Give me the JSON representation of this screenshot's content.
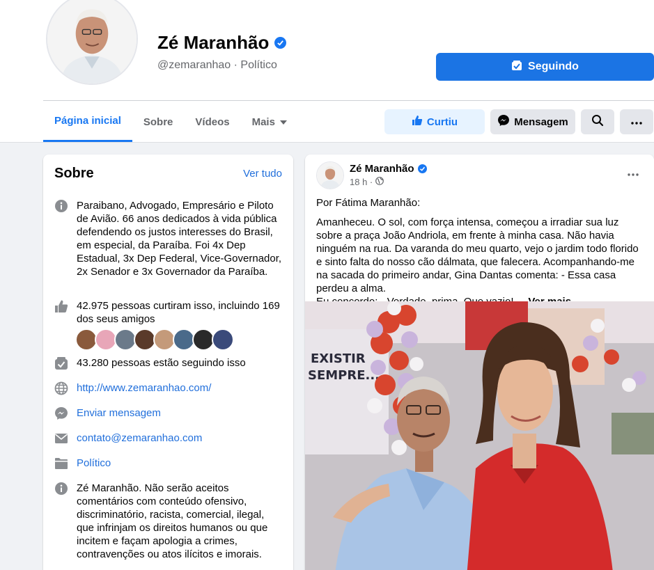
{
  "header": {
    "page_name": "Zé Maranhão",
    "handle": "@zemaranhao · Político",
    "following_button": "Seguindo"
  },
  "tabs": [
    {
      "label": "Página inicial"
    },
    {
      "label": "Sobre"
    },
    {
      "label": "Vídeos"
    },
    {
      "label": "Mais"
    }
  ],
  "actions": {
    "like_label": "Curtiu",
    "message_label": "Mensagem"
  },
  "about": {
    "title": "Sobre",
    "see_all": "Ver tudo",
    "bio": "Paraibano, Advogado, Empresário e Piloto de Avião. 66 anos dedicados à vida pública defendendo os justos interesses do Brasil, em especial, da Paraíba. Foi 4x Dep Estadual, 3x Dep Federal, Vice-Governador, 2x Senador e 3x Governador da Paraíba.",
    "likes": "42.975 pessoas curtiram isso, incluindo 169 dos seus amigos",
    "followers": "43.280 pessoas estão seguindo isso",
    "website": "http://www.zemaranhao.com/",
    "send_message": "Enviar mensagem",
    "email": "contato@zemaranhao.com",
    "category": "Político",
    "rules": "Zé Maranhão. Não serão aceitos comentários com conteúdo ofensivo, discriminatório, racista, comercial, ilegal, que infrinjam os direitos humanos ou que incitem e façam apologia a crimes, contravenções ou atos ilícitos e imorais."
  },
  "friend_avatars": [
    "#8a5a3c",
    "#e8a6b8",
    "#6b7a8a",
    "#5a3a2a",
    "#c49a7a",
    "#4a6a8a",
    "#2a2a2a",
    "#3a4a7a"
  ],
  "post": {
    "author": "Zé Maranhão",
    "time": "18 h ·",
    "text_line1": "Por Fátima Maranhão:",
    "text_body": "Amanheceu. O sol, com força intensa, começou a irradiar sua luz sobre a praça João Andriola, em frente à minha casa. Não havia ninguém na rua. Da varanda do meu quarto, vejo o jardim todo florido e sinto falta do nosso cão dálmata, que falecera. Acompanhando-me na sacada do primeiro andar, Gina Dantas comenta: - Essa casa perdeu a alma.",
    "text_last": "Eu concordo: - Verdade, prima. Que vazio!",
    "see_more": "... Ver mais",
    "photo_banner": "EXISTIR SEMPRE..."
  },
  "colors": {
    "accent": "#1877f2",
    "link": "#216fdb",
    "secondary_text": "#65676b",
    "background": "#f0f2f5"
  }
}
